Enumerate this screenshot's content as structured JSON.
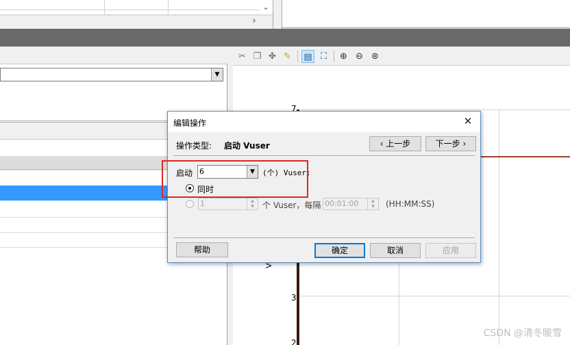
{
  "graph": {
    "y_ticks": [
      "7",
      "3",
      "2"
    ],
    "y_axis_label": "Vuser",
    "colors": {
      "series_line": "#a03c2a",
      "axis": "#3a1a10",
      "selection": "#3399ff"
    }
  },
  "toolbar_icons": [
    "cut-icon",
    "copy-icon",
    "paste-icon",
    "pencil-icon",
    "view-icon",
    "fit-icon",
    "zoom-in-icon",
    "zoom-out-icon",
    "zoom-reset-icon"
  ],
  "dialog": {
    "title": "编辑操作",
    "close_glyph": "✕",
    "op_type_label": "操作类型:",
    "op_type_value": "启动 Vuser",
    "prev_button": "‹ 上一步",
    "next_button": "下一步 ›",
    "start_label": "启动",
    "count_value": "6",
    "unit_text": "(个) Vuser:",
    "option_simultaneous": "同时",
    "option_batch_count": "1",
    "option_batch_text": "个 Vuser，每隔",
    "option_batch_interval": "00:01:00",
    "option_batch_format": "(HH:MM:SS)",
    "help_button": "帮助",
    "ok_button": "确定",
    "cancel_button": "取消",
    "apply_button": "应用"
  },
  "watermark": "CSDN @清冬暖雪"
}
